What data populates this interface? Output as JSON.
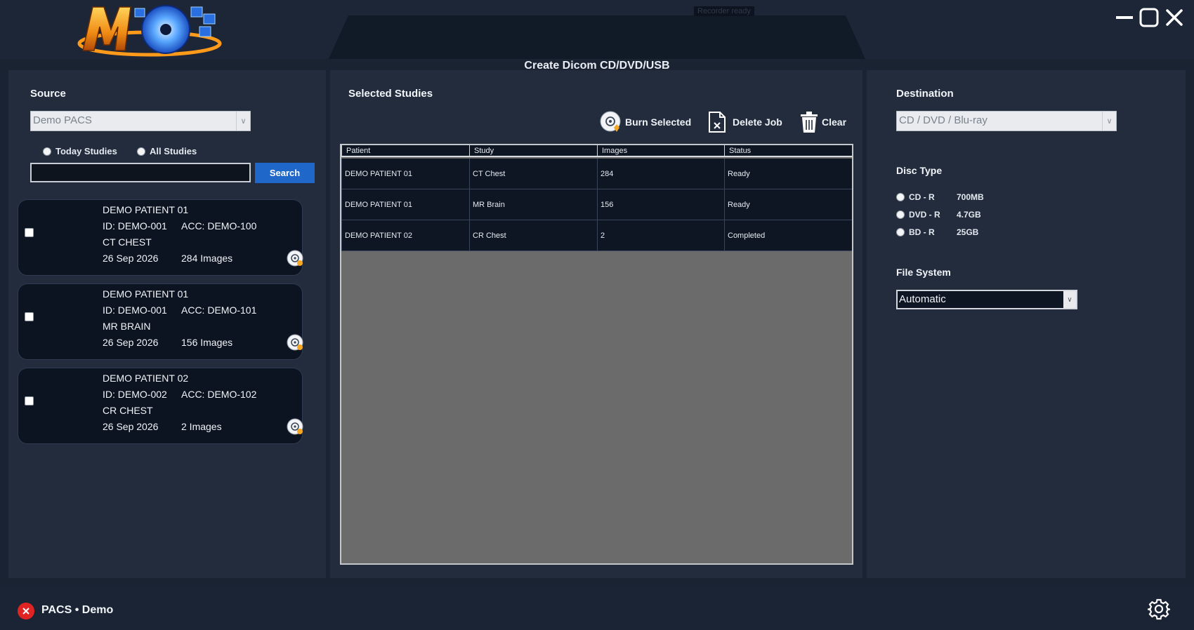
{
  "header": {
    "recorder_status": "Recorder ready",
    "app_title": "Create Dicom CD/DVD/USB"
  },
  "source": {
    "title": "Source",
    "selected": "Demo PACS",
    "radio_today": "Today Studies",
    "radio_all": "All Studies",
    "search_value": "",
    "search_button": "Search",
    "studies": [
      {
        "patient": "DEMO PATIENT 01",
        "id": "ID: DEMO-001",
        "acc": "ACC: DEMO-100",
        "desc": "CT CHEST",
        "date": "26 Sep 2026",
        "images": "284 Images"
      },
      {
        "patient": "DEMO PATIENT 01",
        "id": "ID: DEMO-001",
        "acc": "ACC: DEMO-101",
        "desc": "MR BRAIN",
        "date": "26 Sep 2026",
        "images": "156 Images"
      },
      {
        "patient": "DEMO PATIENT 02",
        "id": "ID: DEMO-002",
        "acc": "ACC: DEMO-102",
        "desc": "CR CHEST",
        "date": "26 Sep 2026",
        "images": "2 Images"
      }
    ]
  },
  "selected": {
    "title": "Selected Studies",
    "burn_label": "Burn Selected",
    "delete_label": "Delete Job",
    "clear_label": "Clear",
    "columns": [
      "Patient",
      "Study",
      "Images",
      "Status"
    ],
    "rows": [
      [
        "DEMO PATIENT 01",
        "CT Chest",
        "284",
        "Ready"
      ],
      [
        "DEMO PATIENT 01",
        "MR Brain",
        "156",
        "Ready"
      ],
      [
        "DEMO PATIENT 02",
        "CR Chest",
        "2",
        "Completed"
      ]
    ]
  },
  "destination": {
    "title": "Destination",
    "selected": "CD / DVD / Blu-ray",
    "disc_type_title": "Disc Type",
    "disc_types": [
      {
        "label": "CD - R",
        "size": "700MB"
      },
      {
        "label": "DVD - R",
        "size": "4.7GB"
      },
      {
        "label": "BD - R",
        "size": "25GB"
      }
    ],
    "fs_title": "File System",
    "fs_selected": "Automatic"
  },
  "footer": {
    "status": "PACS • Demo"
  },
  "colors": {
    "background": "#1a2332",
    "panel": "#222c3c",
    "accent": "#1f67c9",
    "error": "#e02424"
  }
}
